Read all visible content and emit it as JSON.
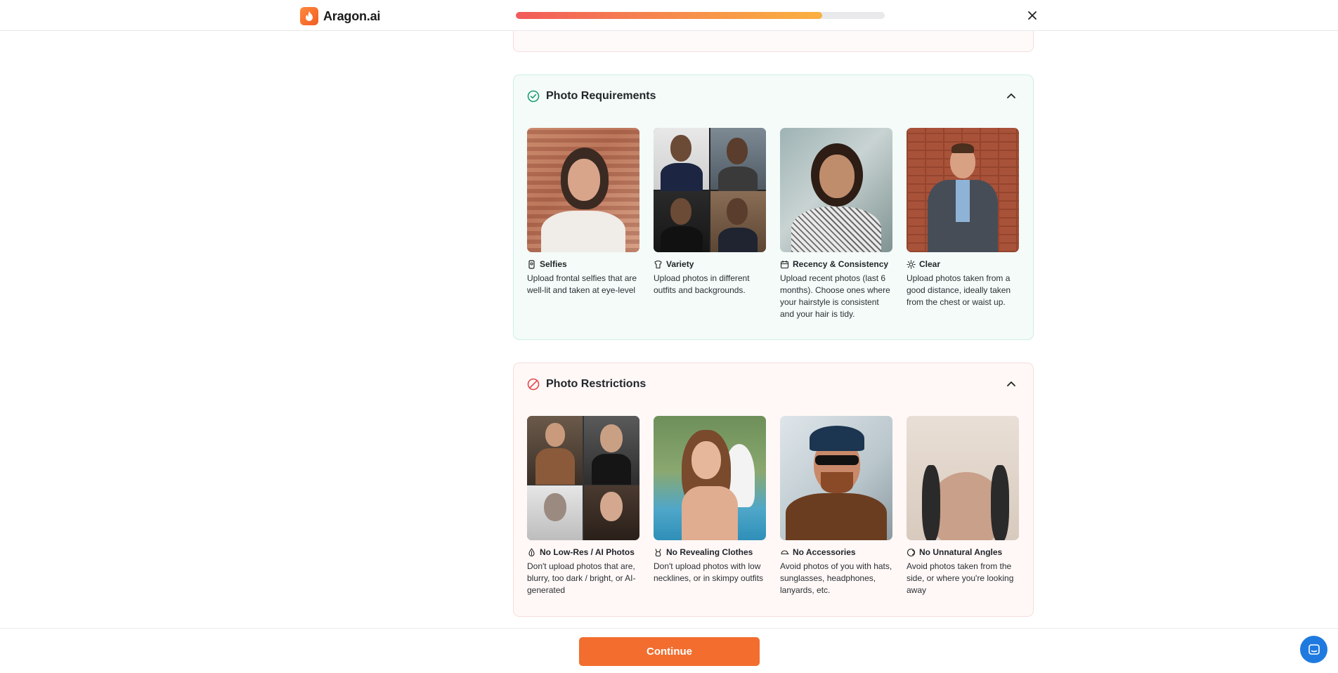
{
  "header": {
    "logo_text": "Aragon.ai",
    "progress_fraction": 0.83
  },
  "requirements": {
    "title": "Photo Requirements",
    "items": [
      {
        "label": "Selfies",
        "desc": "Upload frontal selfies that are well-lit and taken at eye-level",
        "icon": "phone-selfie-icon"
      },
      {
        "label": "Variety",
        "desc": "Upload photos in different outfits and backgrounds.",
        "icon": "shirt-icon"
      },
      {
        "label": "Recency & Consistency",
        "desc": "Upload recent photos (last 6 months). Choose ones where your hairstyle is consistent and your hair is tidy.",
        "icon": "calendar-icon"
      },
      {
        "label": "Clear",
        "desc": "Upload photos taken from a good distance, ideally taken from the chest or waist up.",
        "icon": "sun-icon"
      }
    ]
  },
  "restrictions": {
    "title": "Photo Restrictions",
    "items": [
      {
        "label": "No Low-Res / AI Photos",
        "desc": "Don't upload photos that are, blurry, too dark / bright, or AI-generated",
        "icon": "droplet-icon"
      },
      {
        "label": "No Revealing Clothes",
        "desc": "Don't upload photos with low necklines, or in skimpy outfits",
        "icon": "swimsuit-icon"
      },
      {
        "label": "No Accessories",
        "desc": "Avoid photos of you with hats, sunglasses, headphones, lanyards, etc.",
        "icon": "cap-icon"
      },
      {
        "label": "No Unnatural Angles",
        "desc": "Avoid photos taken from the side, or where you're looking away",
        "icon": "rotate-head-icon"
      }
    ]
  },
  "footer": {
    "continue_label": "Continue"
  },
  "colors": {
    "accent": "#f26d2e",
    "success": "#1e9e72",
    "danger": "#e5484d"
  }
}
